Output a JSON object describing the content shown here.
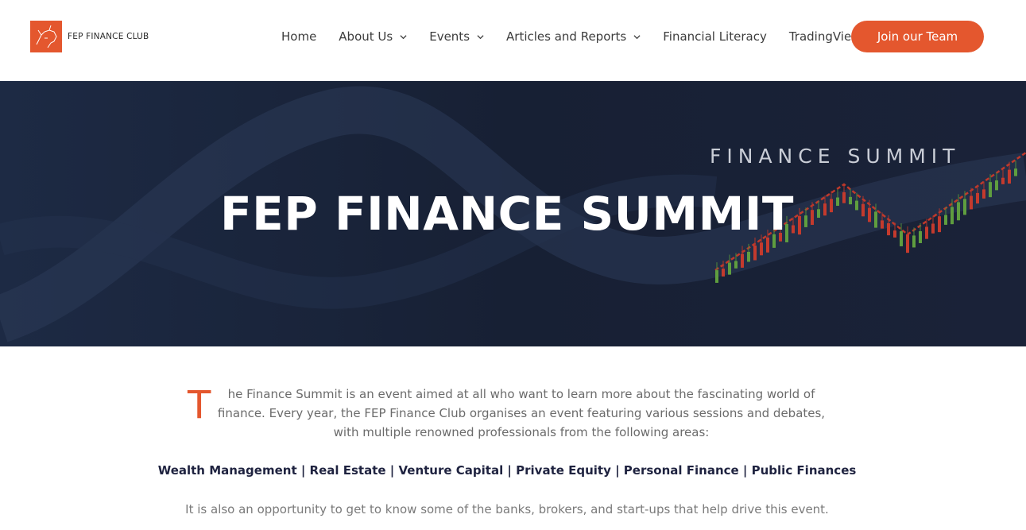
{
  "brand": {
    "name": "FEP FINANCE CLUB",
    "logo_icon": "bull-logo-icon",
    "brand_color": "#e4572e"
  },
  "nav": {
    "items": [
      {
        "label": "Home",
        "dropdown": false
      },
      {
        "label": "About Us",
        "dropdown": true
      },
      {
        "label": "Events",
        "dropdown": true
      },
      {
        "label": "Articles and Reports",
        "dropdown": true
      },
      {
        "label": "Financial Literacy",
        "dropdown": false
      },
      {
        "label": "TradingView",
        "dropdown": false
      }
    ],
    "cta_label": "Join our Team"
  },
  "hero": {
    "title": "FEP FINANCE SUMMIT",
    "overlay_text": "FINANCE SUMMIT",
    "background_color": "#172034"
  },
  "content": {
    "drop_cap": "T",
    "intro": "he Finance Summit is an event aimed at all who want to learn more about the fascinating world of finance. Every year, the FEP Finance Club organises an event featuring various sessions and debates, with multiple renowned professionals from the following areas:",
    "areas": "Wealth Management | Real Estate | Venture Capital | Private Equity | Personal Finance | Public Finances",
    "closing": "It is also an opportunity to get to know some of the banks, brokers, and start-ups that help drive this event."
  }
}
